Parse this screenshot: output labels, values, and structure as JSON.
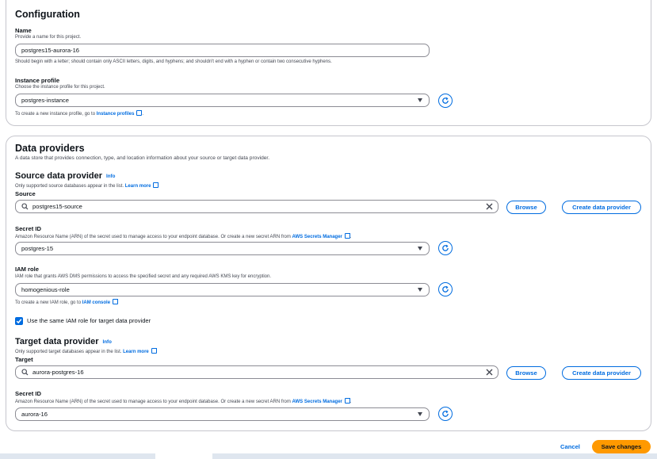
{
  "configuration": {
    "title": "Configuration",
    "name": {
      "label": "Name",
      "description": "Provide a name for this project.",
      "value": "postgres15-aurora-16",
      "constraint": "Should begin with a letter; should contain only ASCII letters, digits, and hyphens; and shouldn't end with a hyphen or contain two consecutive hyphens."
    },
    "instance_profile": {
      "label": "Instance profile",
      "description": "Choose the instance profile for this project.",
      "value": "postgres-instance",
      "hint_prefix": "To create a new instance profile, go to",
      "hint_link": "Instance profiles"
    }
  },
  "data_providers": {
    "title": "Data providers",
    "description": "A data store that provides connection, type, and location information about your source or target data provider.",
    "source": {
      "title": "Source data provider",
      "info": "Info",
      "note": "Only supported source databases appear in the list.",
      "learn_more": "Learn more",
      "label": "Source",
      "value": "postgres15-source",
      "browse": "Browse",
      "create": "Create data provider",
      "secret": {
        "label": "Secret ID",
        "description_prefix": "Amazon Resource Name (ARN) of the secret used to manage access to your endpoint database. Or create a new secret ARN from",
        "link": "AWS Secrets Manager",
        "value": "postgres-15"
      },
      "iam": {
        "label": "IAM role",
        "description": "IAM role that grants AWS DMS permissions to access the specified secret and any required AWS KMS key for encryption.",
        "value": "homogenious-role",
        "hint_prefix": "To create a new IAM role, go to",
        "hint_link": "IAM console"
      },
      "same_role_label": "Use the same IAM role for target data provider"
    },
    "target": {
      "title": "Target data provider",
      "info": "Info",
      "note": "Only supported target databases appear in the list.",
      "learn_more": "Learn more",
      "label": "Target",
      "value": "aurora-postgres-16",
      "browse": "Browse",
      "create": "Create data provider",
      "secret": {
        "label": "Secret ID",
        "description_prefix": "Amazon Resource Name (ARN) of the secret used to manage access to your endpoint database. Or create a new secret ARN from",
        "link": "AWS Secrets Manager",
        "value": "aurora-16"
      }
    }
  },
  "actions": {
    "cancel": "Cancel",
    "save": "Save changes"
  },
  "colors": {
    "primary": "#006ce0",
    "save": "#ff9900",
    "border": "#c6c6cd"
  }
}
